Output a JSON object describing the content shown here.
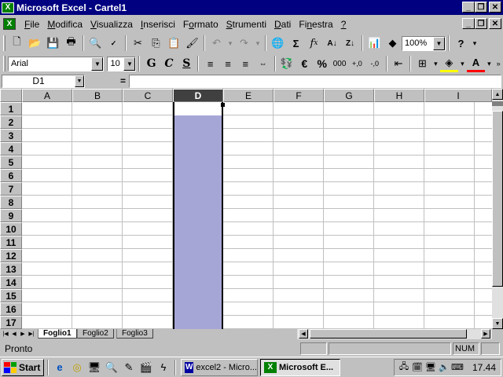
{
  "window": {
    "title": "Microsoft Excel - Cartel1",
    "app_icon": "excel-icon"
  },
  "menu": [
    {
      "label": "File",
      "accel": "F",
      "rest": "ile"
    },
    {
      "label": "Modifica",
      "accel": "M",
      "rest": "odifica"
    },
    {
      "label": "Visualizza",
      "accel": "V",
      "rest": "isualizza"
    },
    {
      "label": "Inserisci",
      "accel": "I",
      "rest": "nserisci"
    },
    {
      "label": "Formato",
      "accel": "o",
      "pre": "F",
      "rest": "rmato"
    },
    {
      "label": "Strumenti",
      "accel": "S",
      "rest": "trumenti"
    },
    {
      "label": "Dati",
      "accel": "D",
      "rest": "ati"
    },
    {
      "label": "Finestra",
      "accel": "n",
      "pre": "Fi",
      "rest": "estra"
    },
    {
      "label": "?",
      "accel": "?",
      "rest": ""
    }
  ],
  "standard_toolbar": {
    "zoom": "100%",
    "icons": [
      "new-icon",
      "open-icon",
      "save-icon",
      "print-icon",
      "print-preview-icon",
      "spelling-icon",
      "cut-icon",
      "copy-icon",
      "paste-icon",
      "format-painter-icon",
      "undo-icon",
      "redo-icon",
      "hyperlink-icon",
      "autosum-icon",
      "function-icon",
      "sort-ascending-icon",
      "sort-descending-icon",
      "chart-wizard-icon",
      "drawing-icon",
      "help-icon"
    ]
  },
  "formatting_toolbar": {
    "font": "Arial",
    "size": "10",
    "bold": "G",
    "italic": "C",
    "underline": "S",
    "currency": "€",
    "percent": "%",
    "thousands": "000"
  },
  "formula_bar": {
    "name_box": "D1",
    "equals": "=",
    "value": ""
  },
  "grid": {
    "columns": [
      "A",
      "B",
      "C",
      "D",
      "E",
      "F",
      "G",
      "H",
      "I"
    ],
    "rows": [
      "1",
      "2",
      "3",
      "4",
      "5",
      "6",
      "7",
      "8",
      "9",
      "10",
      "11",
      "12",
      "13",
      "14",
      "15",
      "16",
      "17"
    ],
    "selected_column": "D"
  },
  "sheets": [
    "Foglio1",
    "Foglio2",
    "Foglio3"
  ],
  "active_sheet": "Foglio1",
  "status": {
    "text": "Pronto",
    "num": "NUM"
  },
  "taskbar": {
    "start": "Start",
    "tasks": [
      {
        "label": "excel2 - Micro...",
        "icon": "word-icon",
        "active": false
      },
      {
        "label": "Microsoft E...",
        "icon": "excel-icon",
        "active": true
      }
    ],
    "clock": "17.44"
  },
  "colors": {
    "title_bar": "#000080",
    "selection": "#a6a6d6",
    "face": "#c0c0c0"
  }
}
